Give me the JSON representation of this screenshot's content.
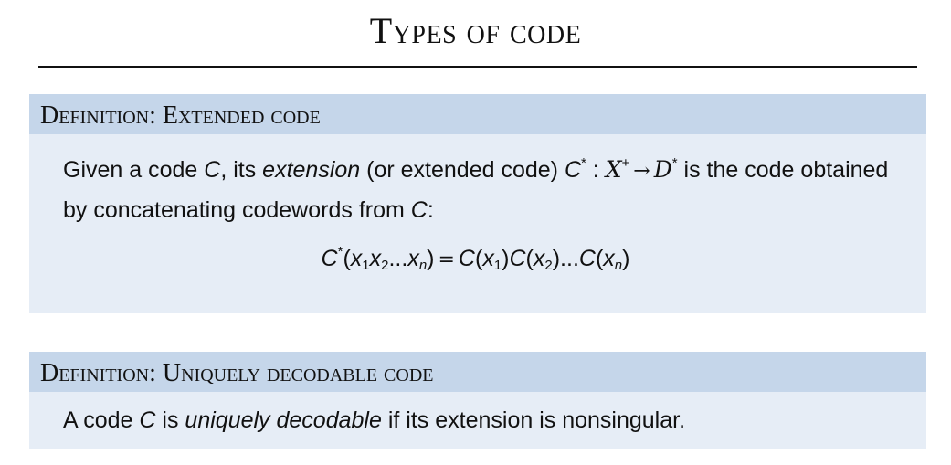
{
  "title": "Types of code",
  "def_extended": {
    "header": "Definition: Extended code",
    "t1": "Given a code ",
    "C": "C",
    "t2": ", its ",
    "extension": "extension",
    "t3": " (or extended code) ",
    "Cstar": "C",
    "star": "*",
    "colon": " : ",
    "calX": "X",
    "plus": "+",
    "arrow": "→",
    "calD": "D",
    "star2": "*",
    "t4": " is the code obtained by concatenating codewords from ",
    "C2": "C",
    "t5": ":",
    "eq": {
      "lhs_C": "C",
      "lhs_star": "*",
      "open": "(",
      "x": "x",
      "s1": "1",
      "s2": "2",
      "s3": "n",
      "dots": "...",
      "close": ")",
      "equals": "=",
      "C": "C",
      "r_open": "(",
      "r_close": ")"
    }
  },
  "def_uniquely": {
    "header": "Definition: Uniquely decodable code",
    "t1": "A code ",
    "C": "C",
    "t2": " is ",
    "uniquely": "uniquely decodable",
    "t3": " if its extension is nonsingular."
  }
}
